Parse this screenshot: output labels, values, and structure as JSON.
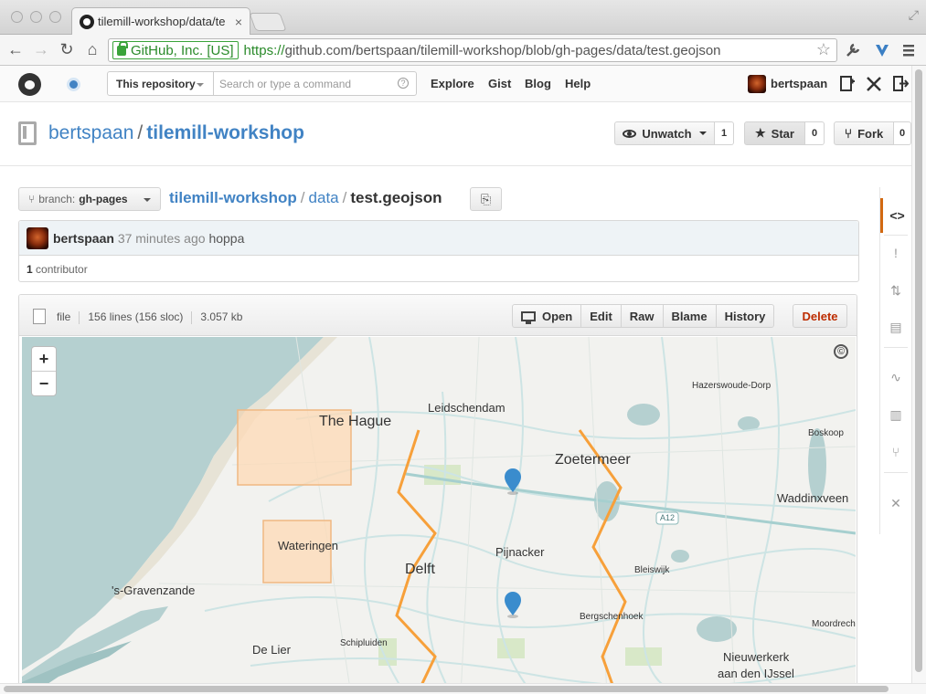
{
  "browser": {
    "tab_title": "tilemill-workshop/data/te",
    "tab_close": "×",
    "ev_label": "GitHub, Inc. [US]",
    "url_scheme": "https://",
    "url_rest": "github.com/bertspaan/tilemill-workshop/blob/gh-pages/data/test.geojson",
    "back": "←",
    "forward": "→",
    "reload": "↻",
    "home": "⌂",
    "star": "☆",
    "fullscreen": "⤢",
    "icons": [
      "wrench-icon",
      "extension-icon",
      "menu-icon"
    ]
  },
  "header": {
    "scope_label": "This repository",
    "search_placeholder": "Search or type a command",
    "help": "?",
    "nav": [
      "Explore",
      "Gist",
      "Blog",
      "Help"
    ],
    "username": "bertspaan"
  },
  "repo": {
    "owner": "bertspaan",
    "separator": "/",
    "name": "tilemill-workshop",
    "unwatch_label": "Unwatch",
    "watch_count": "1",
    "star_label": "Star",
    "star_count": "0",
    "fork_label": "Fork",
    "fork_count": "0"
  },
  "filenav": {
    "branch_prefix": "branch:",
    "branch": "gh-pages",
    "crumbs": [
      "tilemill-workshop",
      "data",
      "test.geojson"
    ]
  },
  "commit": {
    "author": "bertspaan",
    "ago": "37 minutes ago",
    "message": "hoppa",
    "contributor_count": "1",
    "contributor_label": "contributor"
  },
  "file": {
    "mode": "file",
    "lines": "156 lines (156 sloc)",
    "size": "3.057 kb",
    "actions": [
      "Open",
      "Edit",
      "Raw",
      "Blame",
      "History"
    ],
    "delete_label": "Delete"
  },
  "map": {
    "zoom_in": "+",
    "zoom_out": "−",
    "attribution": "©",
    "labels": [
      "Leidschendam",
      "The Hague",
      "Zoetermeer",
      "Hazerswoude-Dorp",
      "Boskoop",
      "Waddinxveen",
      "A12",
      "Wateringen",
      "Delft",
      "Pijnacker",
      "Bleiswijk",
      "'s-Gravenzande",
      "Bergschenhoek",
      "Moordrecht",
      "De Lier",
      "Schipluiden",
      "Nieuwerkerk",
      "aan den IJssel"
    ],
    "colors": {
      "water": "#b5d0d0",
      "land": "#f2f2ef",
      "polygon_fill": "#fdd9b5",
      "polygon_stroke": "#f0b882",
      "line": "#f7a03a",
      "marker": "#3a8ccd",
      "road": "#cde4e4"
    }
  },
  "rail": {
    "items": [
      "<>",
      "!",
      "⇅",
      "▤",
      "∿",
      "▥",
      "⑂",
      "✕"
    ]
  }
}
